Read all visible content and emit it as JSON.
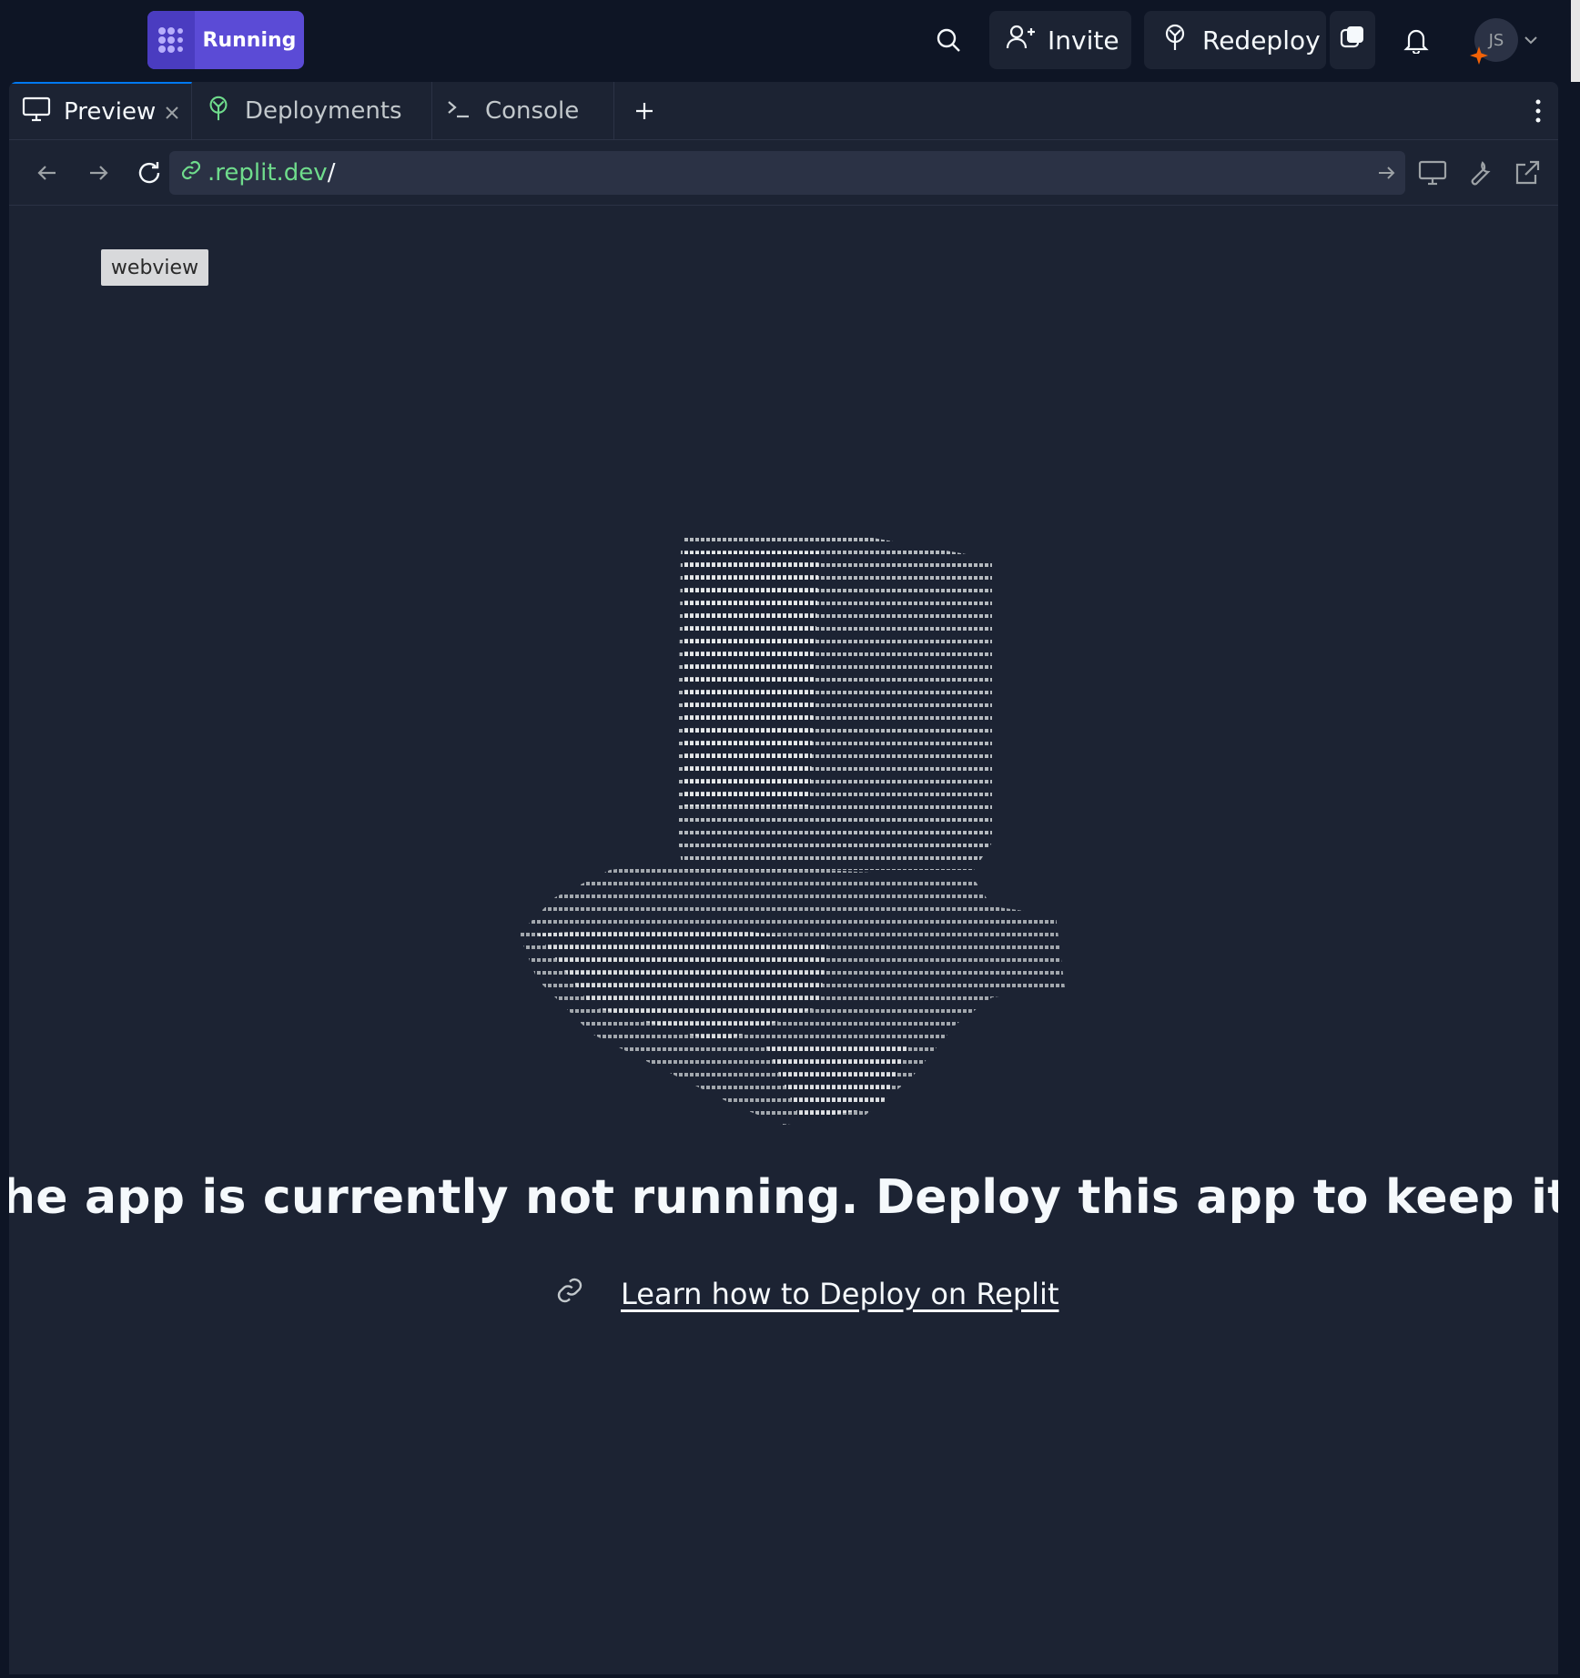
{
  "topbar": {
    "run_button_label": "Running",
    "invite_label": "Invite",
    "redeploy_label": "Redeploy",
    "avatar_initials": "JS"
  },
  "tabs": [
    {
      "label": "Preview",
      "icon": "monitor-icon",
      "active": true
    },
    {
      "label": "Deployments",
      "icon": "deploy-icon",
      "active": false
    },
    {
      "label": "Console",
      "icon": "terminal-icon",
      "active": false
    }
  ],
  "url": {
    "domain": ".replit.dev",
    "path": "/"
  },
  "webview": {
    "tag": "webview",
    "message": "he app is currently not running. Deploy this app to keep it running externall",
    "learn_link": "Learn how to Deploy on Replit"
  },
  "colors": {
    "background": "#0e1525",
    "panel": "#1c2333",
    "accent": "#5b4bd6",
    "url_green": "#6fdc8c"
  }
}
